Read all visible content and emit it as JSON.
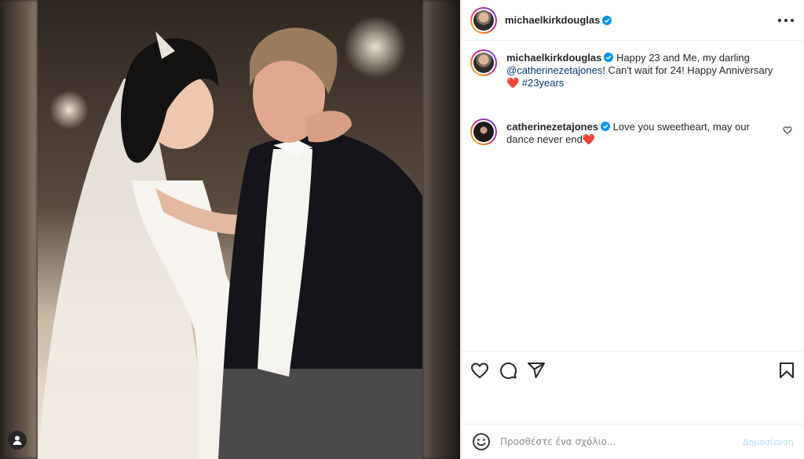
{
  "post": {
    "author": "michaelkirkdouglas",
    "author_avatar_icon": "profile-photo-michaelkirkdouglas",
    "more_icon": "more-options-icon"
  },
  "media": {
    "photo_icon": "wedding-dance-photo",
    "tagged_people_icon": "person-icon"
  },
  "caption": {
    "username": "michaelkirkdouglas",
    "part1": "Happy 23 and Me, my darling ",
    "mention": "@catherinezetajones",
    "part2": "! Can't wait for 24! Happy Anniversary ",
    "heart": "❤️",
    "hashtag": "#23years"
  },
  "comments": [
    {
      "username": "catherinezetajones",
      "text": "Love you sweetheart, may our dance never end",
      "heart": "❤️",
      "like_icon": "heart-outline-icon"
    }
  ],
  "actions": {
    "like_icon": "heart-outline-icon",
    "comment_icon": "comment-icon",
    "share_icon": "paper-plane-icon",
    "save_icon": "bookmark-icon"
  },
  "add_comment": {
    "emoji_icon": "emoji-icon",
    "placeholder": "Προσθέστε ένα σχόλιο...",
    "post_label": "Δημοσίευση"
  },
  "colors": {
    "verified": "#0095f6",
    "link": "#00376b",
    "heart": "#ed4956",
    "post_disabled": "#b2dffc"
  }
}
